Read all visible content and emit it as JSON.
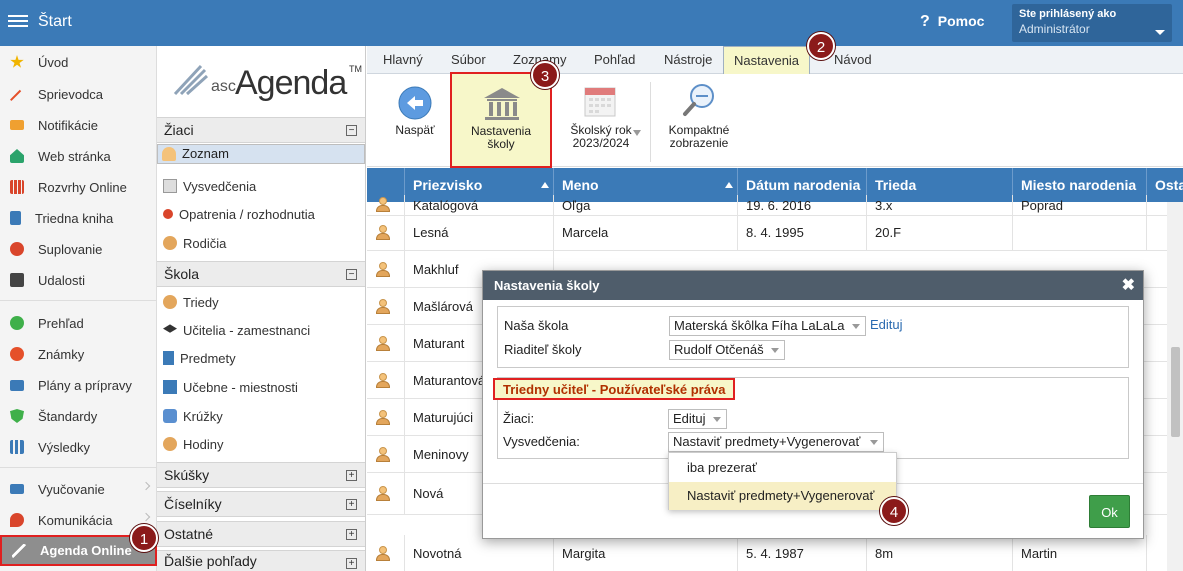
{
  "header": {
    "title": "Štart",
    "help_label": "Pomoc",
    "user_line1": "Ste prihlásený ako",
    "user_line2": "Administrátor"
  },
  "leftnav": {
    "items": [
      {
        "label": "Úvod",
        "icon": "star-icon",
        "color": "#f0b400"
      },
      {
        "label": "Sprievodca",
        "icon": "wand-icon",
        "color": "#e5502a"
      },
      {
        "label": "Notifikácie",
        "icon": "envelope-icon",
        "color": "#f0a030"
      },
      {
        "label": "Web stránka",
        "icon": "house-icon",
        "color": "#2aa36b"
      },
      {
        "label": "Rozvrhy Online",
        "icon": "grid-icon",
        "color": "#d9452b"
      },
      {
        "label": "Triedna kniha",
        "icon": "book-icon",
        "color": "#3b7ab7"
      },
      {
        "label": "Suplovanie",
        "icon": "person-icon",
        "color": "#d9452b"
      },
      {
        "label": "Udalosti",
        "icon": "calendar-icon",
        "color": "#444444"
      },
      {
        "label": "Prehľad",
        "icon": "check-circle-icon",
        "color": "#3fb04a"
      },
      {
        "label": "Známky",
        "icon": "chart-circle-icon",
        "color": "#e5502a"
      },
      {
        "label": "Plány a prípravy",
        "icon": "briefcase-icon",
        "color": "#3b7ab7"
      },
      {
        "label": "Štandardy",
        "icon": "shield-icon",
        "color": "#3fb04a"
      },
      {
        "label": "Výsledky",
        "icon": "bar-chart-icon",
        "color": "#3b7ab7"
      },
      {
        "label": "Vyučovanie",
        "icon": "open-book-icon",
        "color": "#3b7ab7"
      },
      {
        "label": "Komunikácia",
        "icon": "chat-icon",
        "color": "#d9452b"
      },
      {
        "label": "Agenda Online",
        "icon": "agenda-logo-icon",
        "color": "#ffffff"
      }
    ]
  },
  "sidebar2": {
    "logo_small": "asc",
    "logo_main": "Agenda",
    "logo_tm": "TM",
    "sections": {
      "ziaci": "Žiaci",
      "skola": "Škola",
      "skusky": "Skúšky",
      "ciselniky": "Číselníky",
      "ostatne": "Ostatné",
      "dalsie": "Ďalšie pohľady"
    },
    "ziaci_items": [
      "Zoznam",
      "Vysvedčenia",
      "Opatrenia / rozhodnutia",
      "Rodičia"
    ],
    "skola_items": [
      "Triedy",
      "Učitelia - zamestnanci",
      "Predmety",
      "Učebne - miestnosti",
      "Krúžky",
      "Hodiny"
    ]
  },
  "tabs": [
    "Hlavný",
    "Súbor",
    "Zoznamy",
    "Pohľad",
    "Nástroje",
    "Nastavenia",
    "Návod"
  ],
  "toolbar": {
    "back_label": "Naspäť",
    "school_settings_line1": "Nastavenia",
    "school_settings_line2": "školy",
    "school_year_line1": "Školský rok",
    "school_year_line2": "2023/2024",
    "compact_line1": "Kompaktné",
    "compact_line2": "zobrazenie"
  },
  "grid": {
    "columns": [
      "Priezvisko",
      "Meno",
      "Dátum narodenia",
      "Trieda",
      "Miesto narodenia",
      "Osta"
    ],
    "rows": [
      [
        "Katalógová",
        "Oľga",
        "19. 6. 2016",
        "3.x",
        "Poprad"
      ],
      [
        "Lesná",
        "Marcela",
        "8. 4. 1995",
        "20.F",
        ""
      ],
      [
        "Makhluf",
        "",
        "",
        "",
        ""
      ],
      [
        "Mašlárová",
        "",
        "",
        "",
        ""
      ],
      [
        "Maturant",
        "",
        "",
        "",
        ""
      ],
      [
        "Maturantová",
        "",
        "",
        "",
        ""
      ],
      [
        "Maturujúci",
        "",
        "",
        "",
        ""
      ],
      [
        "Meninovy",
        "",
        "",
        "",
        ""
      ],
      [
        "Nová",
        "",
        "",
        "",
        ""
      ],
      [
        "Novotná",
        "Margita",
        "5. 4. 1987",
        "8m",
        "Martin"
      ]
    ]
  },
  "modal": {
    "title": "Nastavenia školy",
    "close": "✖",
    "our_school_label": "Naša škola",
    "our_school_value": "Materská škôlka Fíha LaLaLa",
    "edit_link": "Edituj",
    "director_label": "Riaditeľ školy",
    "director_value": "Rudolf Otčenáš",
    "section_title": "Triedny učiteľ - Používateľské práva",
    "students_label": "Žiaci:",
    "students_value": "Edituj",
    "certificates_label": "Vysvedčenia:",
    "certificates_value": "Nastaviť predmety+Vygenerovať",
    "ok_label": "Ok"
  },
  "dropdown": {
    "options": [
      "iba prezerať",
      "Nastaviť predmety+Vygenerovať"
    ]
  },
  "badges": [
    "1",
    "2",
    "3",
    "4"
  ]
}
